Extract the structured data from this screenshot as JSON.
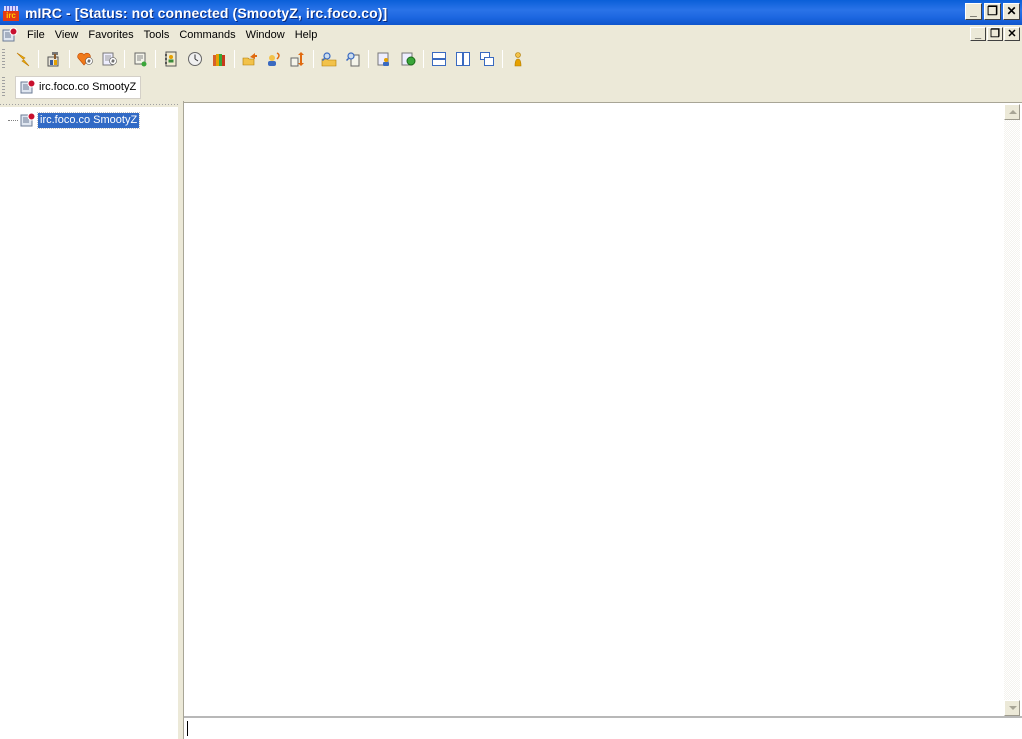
{
  "window": {
    "title": "mIRC - [Status: not connected (SmootyZ, irc.foco.co)]",
    "app_icon": "mirc-logo-icon",
    "controls": {
      "minimize": "_",
      "restore": "❐",
      "close": "✕"
    }
  },
  "menubar": {
    "doc_icon": "status-window-icon",
    "items": [
      "File",
      "View",
      "Favorites",
      "Tools",
      "Commands",
      "Window",
      "Help"
    ],
    "mdi_controls": {
      "minimize": "_",
      "restore": "❐",
      "close": "✕"
    }
  },
  "toolbar": {
    "buttons": [
      {
        "name": "connect",
        "icon": "lightning-icon"
      },
      {
        "sep": true
      },
      {
        "name": "options",
        "icon": "toolbox-hammer-icon"
      },
      {
        "sep": true
      },
      {
        "name": "favorites",
        "icon": "heart-channel-icon"
      },
      {
        "name": "channels-list",
        "icon": "channel-list-icon"
      },
      {
        "sep": true
      },
      {
        "name": "scripts-editor",
        "icon": "script-scroll-icon"
      },
      {
        "sep": true
      },
      {
        "name": "address-book",
        "icon": "address-book-icon"
      },
      {
        "name": "timer",
        "icon": "clock-icon"
      },
      {
        "name": "colors",
        "icon": "crayons-icon"
      },
      {
        "sep": true
      },
      {
        "name": "send-file",
        "icon": "folder-send-icon"
      },
      {
        "name": "chat",
        "icon": "users-chat-icon"
      },
      {
        "name": "dcc-options",
        "icon": "dcc-transfer-icon"
      },
      {
        "sep": true
      },
      {
        "name": "logs",
        "icon": "folder-search-icon"
      },
      {
        "name": "notify",
        "icon": "document-search-icon"
      },
      {
        "sep": true
      },
      {
        "name": "url-catcher",
        "icon": "user-list-icon"
      },
      {
        "name": "online-timer",
        "icon": "globe-list-icon"
      },
      {
        "sep": true
      },
      {
        "name": "tile-horizontal",
        "icon": "tile-horizontal-icon"
      },
      {
        "name": "tile-vertical",
        "icon": "tile-vertical-icon"
      },
      {
        "name": "cascade",
        "icon": "cascade-icon"
      },
      {
        "sep": true
      },
      {
        "name": "help",
        "icon": "help-person-icon"
      }
    ]
  },
  "switchbar": {
    "items": [
      {
        "label": "irc.foco.co SmootyZ",
        "icon": "status-window-icon"
      }
    ]
  },
  "treebar": {
    "items": [
      {
        "label": "irc.foco.co SmootyZ",
        "icon": "status-window-icon",
        "selected": true
      }
    ]
  },
  "status_window": {
    "content": "",
    "editbox_value": ""
  },
  "colors": {
    "titlebar": "#2a73e8",
    "selection": "#316ac5",
    "chrome": "#ece9d8"
  }
}
